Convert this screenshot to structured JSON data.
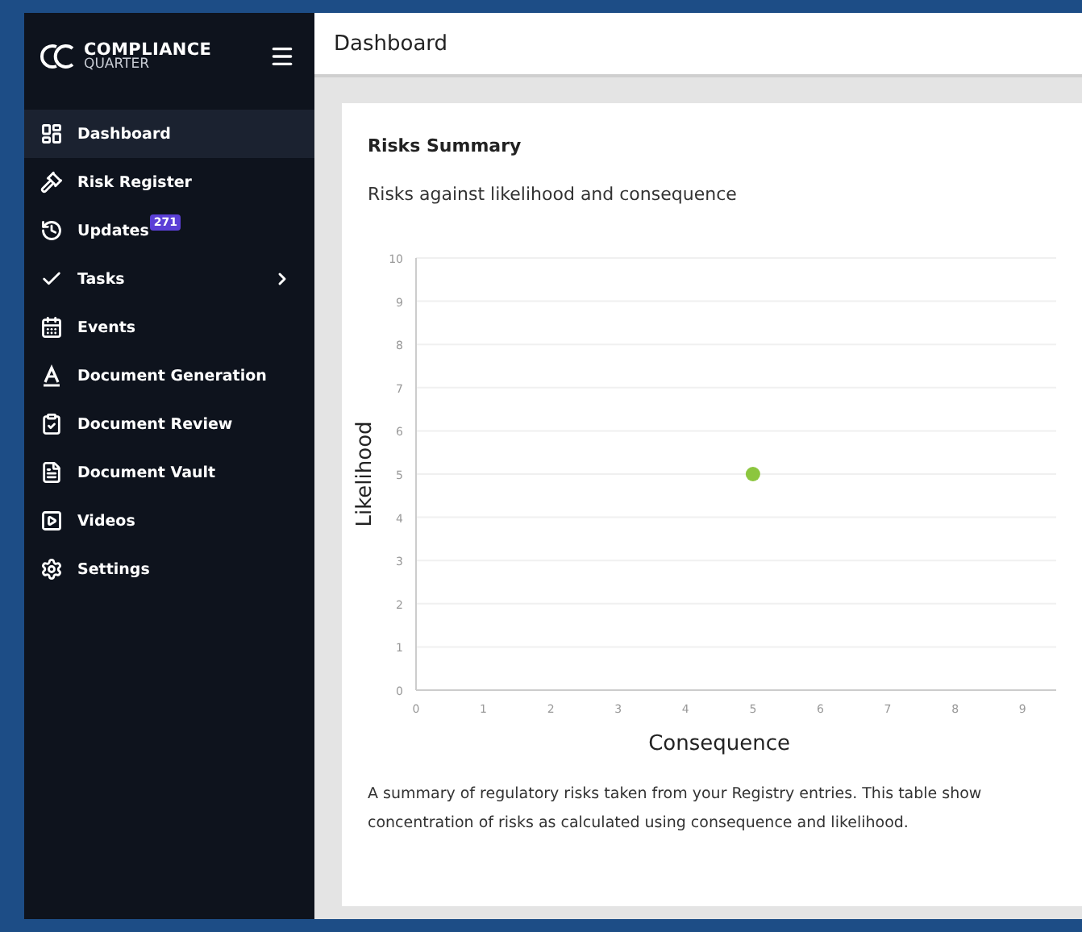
{
  "sidebar": {
    "logo": {
      "line_1": "COMPLIANCE",
      "line_2": "QUARTER"
    },
    "items": [
      {
        "kind": "dashboard",
        "label": "Dashboard",
        "selected": true
      },
      {
        "kind": "register",
        "label": "Risk Register",
        "selected": false
      },
      {
        "kind": "updates",
        "label": "Updates",
        "badge": "271",
        "selected": false
      },
      {
        "kind": "tasks",
        "label": "Tasks",
        "expanded": false,
        "selected": false
      },
      {
        "kind": "events",
        "label": "Events",
        "selected": false
      },
      {
        "kind": "generation",
        "label": "Document Generation",
        "selected": false
      },
      {
        "kind": "review",
        "label": "Document Review",
        "selected": false
      },
      {
        "kind": "vault",
        "label": "Document Vault",
        "selected": false
      },
      {
        "kind": "videos",
        "label": "Videos",
        "selected": false
      },
      {
        "kind": "settings",
        "label": "Settings",
        "selected": false
      }
    ]
  },
  "header": {
    "title": "Dashboard"
  },
  "card": {
    "title": "Risks Summary",
    "subtitle": "Risks against likelihood and consequence",
    "chart_data": {
      "type": "scatter",
      "xlabel": "Consequence",
      "ylabel": "Likelihood",
      "xlim": [
        0,
        9.5
      ],
      "ylim": [
        0,
        10
      ],
      "xticks": [
        0,
        1,
        2,
        3,
        4,
        5,
        6,
        7,
        8,
        9
      ],
      "yticks": [
        0,
        1,
        2,
        3,
        4,
        5,
        6,
        7,
        8,
        9,
        10
      ],
      "grid": true,
      "series": [
        {
          "color": "#8cc63f",
          "x": [
            5
          ],
          "values": [
            5
          ]
        }
      ]
    },
    "description_lines": [
      "A summary of regulatory risks taken from your Registry entries. This table show",
      "concentration of risks as calculated using consequence and likelihood."
    ]
  }
}
